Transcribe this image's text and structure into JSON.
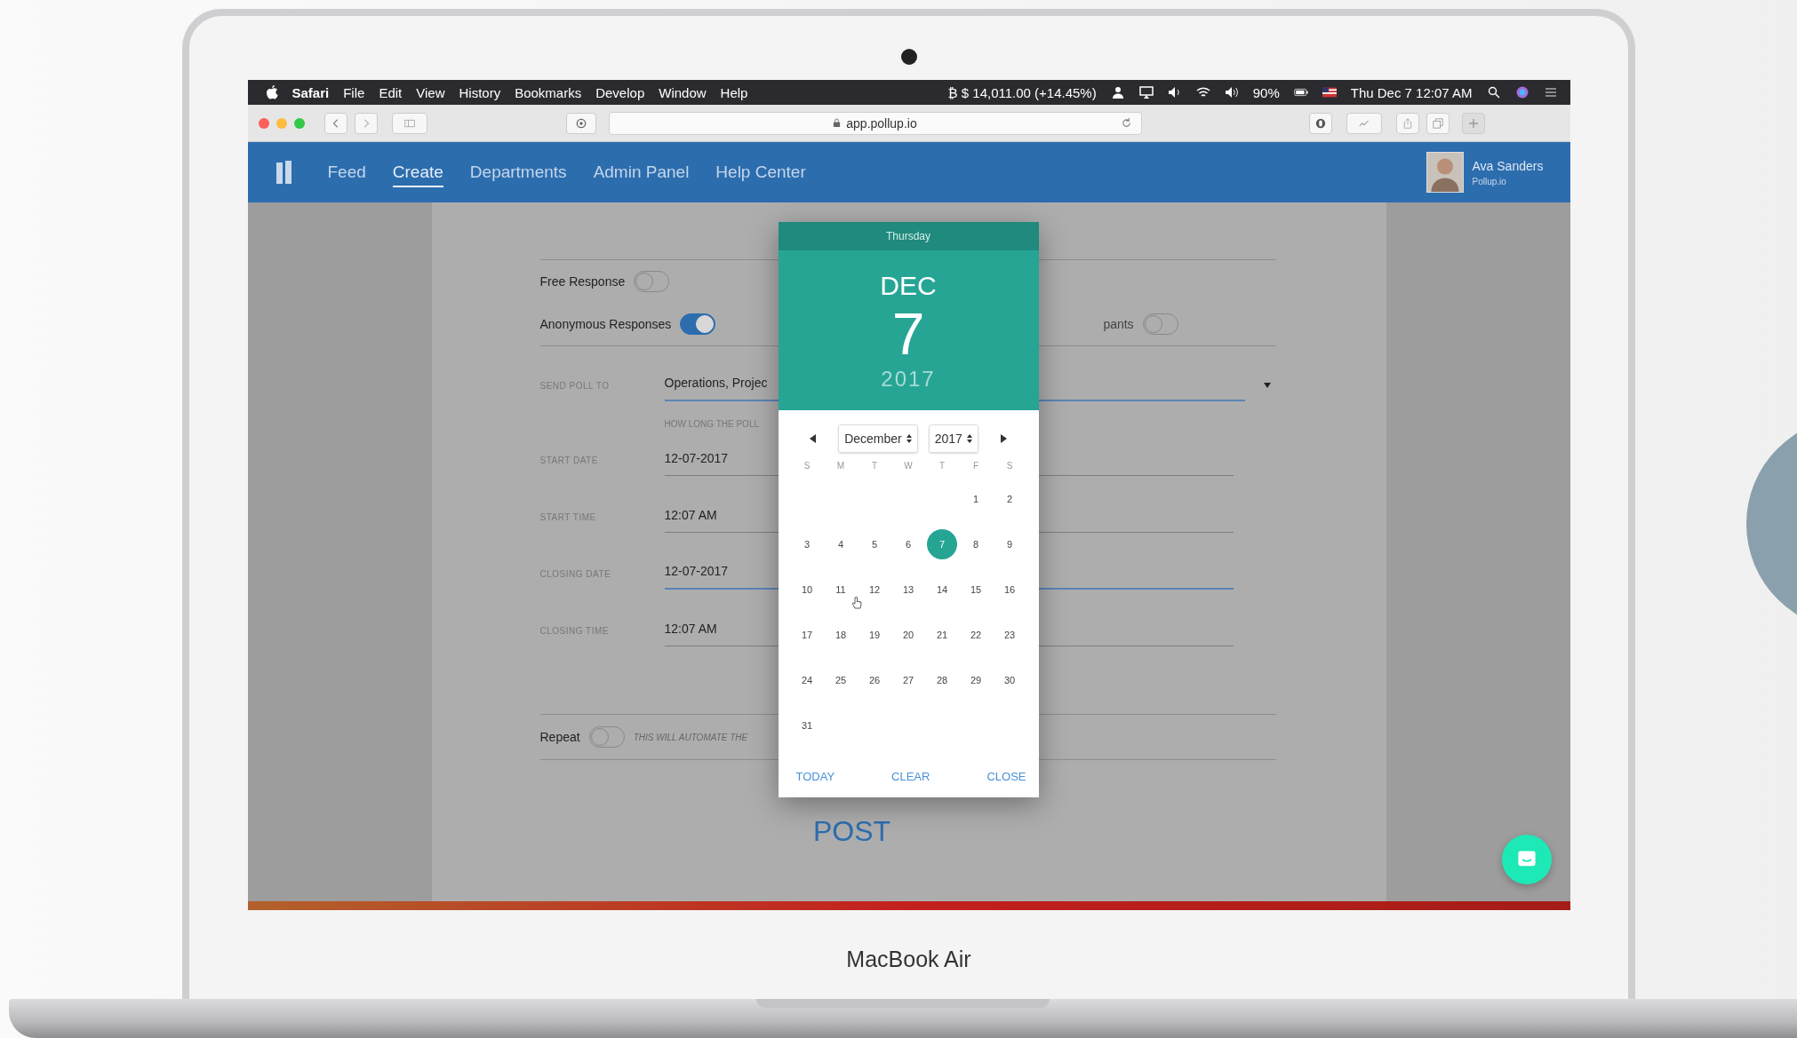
{
  "menu_bar": {
    "app": "Safari",
    "items": [
      "File",
      "Edit",
      "View",
      "History",
      "Bookmarks",
      "Develop",
      "Window",
      "Help"
    ],
    "ticker": "₿ $ 14,011.00 (+14.45%)",
    "battery": "90%",
    "clock": "Thu Dec 7  12:07 AM"
  },
  "browser": {
    "url": "app.pollup.io"
  },
  "nav": {
    "items": [
      {
        "label": "Feed",
        "selected": false
      },
      {
        "label": "Create",
        "selected": true
      },
      {
        "label": "Departments",
        "selected": false
      },
      {
        "label": "Admin Panel",
        "selected": false
      },
      {
        "label": "Help Center",
        "selected": false
      }
    ],
    "user": {
      "name": "Ava Sanders",
      "org": "Pollup.io"
    }
  },
  "form": {
    "toggles": [
      {
        "label": "Free Response",
        "on": false
      },
      {
        "label": "Anonymous Responses",
        "on": true
      }
    ],
    "side_toggle": {
      "label": "pants",
      "on": false
    },
    "send_to": {
      "label": "SEND POLL TO",
      "value": "Operations, Projec",
      "focused": true
    },
    "duration_hint": "HOW LONG THE POLL",
    "fields": [
      {
        "label": "START DATE",
        "value": "12-07-2017",
        "focused": false
      },
      {
        "label": "START TIME",
        "value": "12:07 AM",
        "focused": false
      },
      {
        "label": "CLOSING DATE",
        "value": "12-07-2017",
        "focused": true
      },
      {
        "label": "CLOSING TIME",
        "value": "12:07 AM",
        "focused": false
      }
    ],
    "repeat": {
      "label": "Repeat",
      "on": false,
      "hint": "THIS WILL AUTOMATE THE"
    },
    "post": "POST"
  },
  "date_picker": {
    "weekday": "Thursday",
    "month": "DEC",
    "day": "7",
    "year": "2017",
    "month_select": "December",
    "year_select": "2017",
    "weekday_heads": [
      "S",
      "M",
      "T",
      "W",
      "T",
      "F",
      "S"
    ],
    "weeks": [
      [
        {
          "label": "1",
          "selected": false
        },
        {
          "label": "2",
          "selected": false
        }
      ],
      [
        {
          "label": "3",
          "selected": false
        },
        {
          "label": "4",
          "selected": false
        },
        {
          "label": "5",
          "selected": false
        },
        {
          "label": "6",
          "selected": false
        },
        {
          "label": "7",
          "selected": true
        },
        {
          "label": "8",
          "selected": false
        },
        {
          "label": "9",
          "selected": false
        }
      ],
      [
        {
          "label": "10",
          "selected": false
        },
        {
          "label": "11",
          "selected": false
        },
        {
          "label": "12",
          "selected": false
        },
        {
          "label": "13",
          "selected": false
        },
        {
          "label": "14",
          "selected": false
        },
        {
          "label": "15",
          "selected": false
        },
        {
          "label": "16",
          "selected": false
        }
      ],
      [
        {
          "label": "17",
          "selected": false
        },
        {
          "label": "18",
          "selected": false
        },
        {
          "label": "19",
          "selected": false
        },
        {
          "label": "20",
          "selected": false
        },
        {
          "label": "21",
          "selected": false
        },
        {
          "label": "22",
          "selected": false
        },
        {
          "label": "23",
          "selected": false
        }
      ],
      [
        {
          "label": "24",
          "selected": false
        },
        {
          "label": "25",
          "selected": false
        },
        {
          "label": "26",
          "selected": false
        },
        {
          "label": "27",
          "selected": false
        },
        {
          "label": "28",
          "selected": false
        },
        {
          "label": "29",
          "selected": false
        },
        {
          "label": "30",
          "selected": false
        }
      ],
      [
        {
          "label": "31",
          "selected": false
        }
      ]
    ],
    "actions": [
      "TODAY",
      "CLEAR",
      "CLOSE"
    ]
  },
  "device": {
    "label": "MacBook Air"
  }
}
